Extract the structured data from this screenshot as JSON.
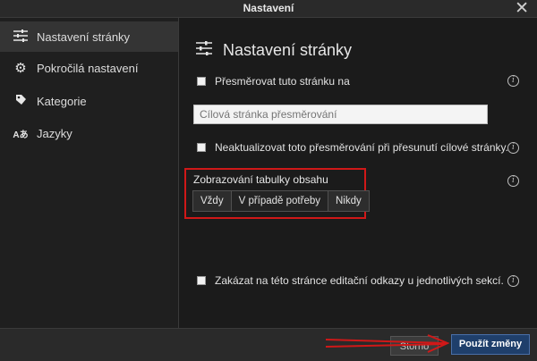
{
  "window": {
    "title": "Nastavení"
  },
  "sidebar": {
    "items": [
      {
        "label": "Nastavení stránky",
        "icon": "sliders-icon",
        "active": true
      },
      {
        "label": "Pokročilá nastavení",
        "icon": "gear-icon",
        "active": false
      },
      {
        "label": "Kategorie",
        "icon": "tag-icon",
        "active": false
      },
      {
        "label": "Jazyky",
        "icon": "language-icon",
        "active": false
      }
    ]
  },
  "main": {
    "heading": "Nastavení stránky",
    "redirect_label": "Přesměrovat tuto stránku na",
    "redirect_placeholder": "Cílová stránka přesměrování",
    "dont_update_label": "Neaktualizovat toto přesměrování při přesunutí cílové stránky.",
    "toc": {
      "label": "Zobrazování tabulky obsahu",
      "options": [
        "Vždy",
        "V případě potřeby",
        "Nikdy"
      ],
      "selected": "V případě potřeby"
    },
    "disable_edit_label": "Zakázat na této stránce editační odkazy u jednotlivých sekcí."
  },
  "footer": {
    "cancel_label": "Storno",
    "apply_label": "Použít změny"
  },
  "annotation_color": "#d01818"
}
